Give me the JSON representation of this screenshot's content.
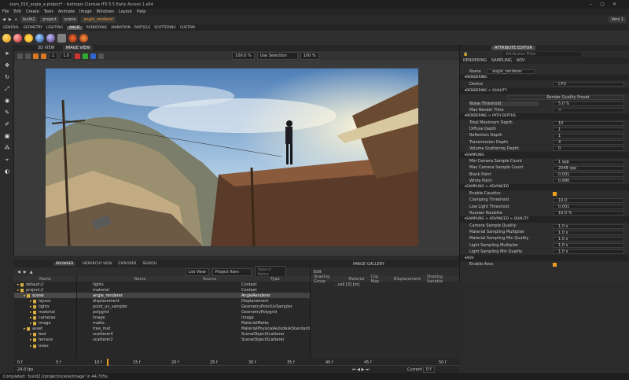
{
  "window": {
    "title": "slum_010_angie_e.project* - Isotropix Clarisse iFX 5.5 Early Access 1.x64"
  },
  "menu": [
    "File",
    "Edit",
    "Create",
    "Tools",
    "Animate",
    "Image",
    "Windows",
    "Layout",
    "Help"
  ],
  "breadcrumb": {
    "items": [
      "build2",
      "project",
      "scene"
    ],
    "current": "angie_renderer",
    "version": "Vers 1"
  },
  "workspace_tabs": [
    "GENERAL",
    "GEOMETRY",
    "LIGHTING",
    "ANGIE",
    "RENDERING",
    "ANIMATION",
    "PARTICLE",
    "SCATTERING",
    "CUSTOM"
  ],
  "workspace_active": "ANGIE",
  "viewport": {
    "tabs": [
      "3D VIEW",
      "IMAGE VIEW"
    ],
    "active": "IMAGE VIEW",
    "zoom": "100.0 %",
    "selection": "Use Selection",
    "ratio": "100 %",
    "frame_a": "1",
    "frame_b": "1.0"
  },
  "attr": {
    "tabs": [
      "ATTRIBUTE EDITOR"
    ],
    "subtabs": [
      "RENDERING",
      "SAMPLING",
      "AOV"
    ],
    "filter": "Attributes Filter",
    "name_label": "Name",
    "name": "angie_renderer",
    "rows": [
      {
        "t": "sec",
        "l": "RENDERING"
      },
      {
        "l": "Device",
        "v": "CPU"
      },
      {
        "t": "sec",
        "l": "RENDERING > QUALITY"
      },
      {
        "l": "",
        "v": "Render Quality Preset",
        "c": 1
      },
      {
        "l": "Noise Threshold",
        "v": "5.0 %",
        "h": 1
      },
      {
        "l": "Max Render Time",
        "v": "∞"
      },
      {
        "t": "sec",
        "l": "RENDERING > PATH DEPTHS"
      },
      {
        "l": "Total Maximum Depth",
        "v": "10"
      },
      {
        "l": "Diffuse Depth",
        "v": "1"
      },
      {
        "l": "Reflection Depth",
        "v": "1"
      },
      {
        "l": "Transmission Depth",
        "v": "4"
      },
      {
        "l": "Volume Scattering Depth",
        "v": "0"
      },
      {
        "t": "sec",
        "l": "SAMPLING"
      },
      {
        "l": "Min Camera Sample Count",
        "v": "1 spp"
      },
      {
        "l": "Max Camera Sample Count",
        "v": "2048 spp"
      },
      {
        "l": "Black Point",
        "v": "0.001"
      },
      {
        "l": "White Point",
        "v": "0.990"
      },
      {
        "t": "sec",
        "l": "SAMPLING > ADVANCED"
      },
      {
        "l": "Enable Caustics",
        "k": 1
      },
      {
        "l": "Clamping Threshold",
        "v": "10.0"
      },
      {
        "l": "Low Light Threshold",
        "v": "0.001"
      },
      {
        "l": "Russian Roulette",
        "v": "10.0 %"
      },
      {
        "t": "sec",
        "l": "SAMPLING > ADVANCED > QUALITY"
      },
      {
        "l": "Camera Sample Quality",
        "v": "1.0 x"
      },
      {
        "l": "Material Sampling Multiplier",
        "v": "1.0 x"
      },
      {
        "l": "Material Sampling Min Quality",
        "v": "1.0 x"
      },
      {
        "l": "Light Sampling Multiplier",
        "v": "1.0 x"
      },
      {
        "l": "Light Sampling Min Quality",
        "v": "1.0 x"
      },
      {
        "t": "sec",
        "l": "AOV"
      },
      {
        "l": "Enable Aovs",
        "k": 1
      }
    ]
  },
  "browser": {
    "tabs": [
      "BROWSER",
      "HIERARCHY VIEW",
      "EXPLORER",
      "SEARCH"
    ],
    "active": "BROWSER",
    "view": "List View",
    "filter": "Project Item",
    "search": "Search Items",
    "tree_header": "Name",
    "tree": [
      {
        "n": "default://",
        "d": 0
      },
      {
        "n": "project://",
        "d": 0
      },
      {
        "n": "scene",
        "d": 1,
        "s": 1
      },
      {
        "n": "layout",
        "d": 2
      },
      {
        "n": "lights",
        "d": 2
      },
      {
        "n": "material",
        "d": 2
      },
      {
        "n": "cameras",
        "d": 2
      },
      {
        "n": "image",
        "d": 2
      },
      {
        "n": "asset",
        "d": 1
      },
      {
        "n": "bed",
        "d": 2
      },
      {
        "n": "terrace",
        "d": 2
      },
      {
        "n": "trees",
        "d": 2
      }
    ],
    "cols": [
      "Name",
      "Source",
      "Type"
    ],
    "items": [
      {
        "n": "lights",
        "t": "Context"
      },
      {
        "n": "material",
        "t": "Context"
      },
      {
        "n": "angie_renderer",
        "t": "AngieRenderer",
        "s": 1
      },
      {
        "n": "displacement",
        "t": "Displacement"
      },
      {
        "n": "point_uv_sampler",
        "t": "GeometryPointUvSampler"
      },
      {
        "n": "polygrid",
        "t": "GeometryPolygrid"
      },
      {
        "n": "image",
        "t": "Image"
      },
      {
        "n": "matte",
        "t": "MaterialMatte"
      },
      {
        "n": "tree_mat",
        "t": "MaterialPhysicalAutodeskStandard"
      },
      {
        "n": "scatterer4",
        "t": "SceneObjectScatterer"
      },
      {
        "n": "scatterer2",
        "t": "SceneObjectScatterer"
      }
    ]
  },
  "graph": {
    "tabs": [
      "IMAGE GALLERY"
    ],
    "edit": "Edit",
    "cols": [
      "Shading Group",
      "Material",
      "Clip Map",
      "Displacement",
      "Shading Variable"
    ],
    "row": "...cell [3] [m]"
  },
  "timeline": {
    "start": "0 f",
    "end": "24.0 fps",
    "ticks": [
      "0 f",
      "5 f",
      "10 f",
      "15 f",
      "20 f",
      "25 f",
      "30 f",
      "35 f",
      "40 f",
      "45 f"
    ],
    "current_label": "Current",
    "current": "0 f",
    "end_frame": "50 f"
  },
  "status": {
    "text": "Completed: 'build2://project/scene/image' in 44.705s."
  }
}
